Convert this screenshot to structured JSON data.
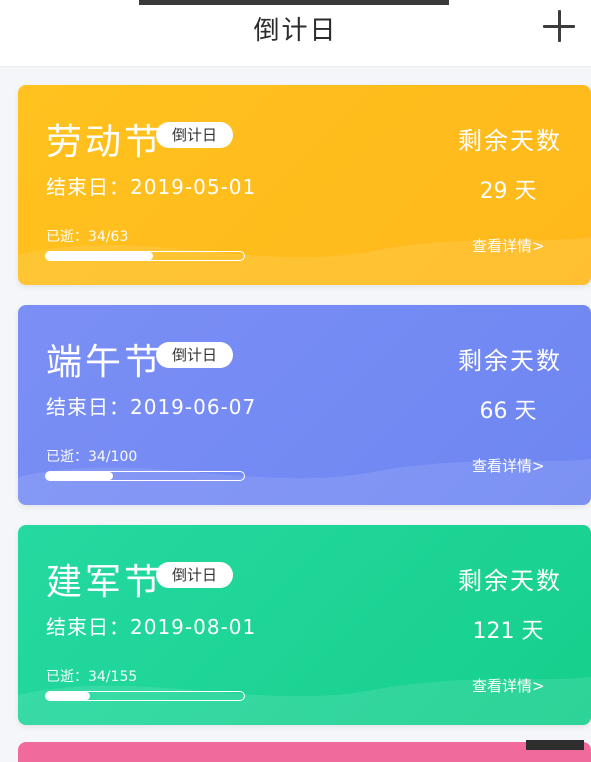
{
  "header": {
    "title": "倒计日",
    "add_icon": "plus-icon"
  },
  "cards": [
    {
      "name": "劳动节",
      "badge": "倒计日",
      "end_date": "结束日：2019-05-01",
      "elapsed": "已逝：34/63",
      "progress": 0.54,
      "remaining_label": "剩余天数",
      "days": "29 天",
      "details": "查看详情>",
      "color_start": "#ffc21f",
      "color_end": "#ffb81a"
    },
    {
      "name": "端午节",
      "badge": "倒计日",
      "end_date": "结束日：2019-06-07",
      "elapsed": "已逝：34/100",
      "progress": 0.34,
      "remaining_label": "剩余天数",
      "days": "66 天",
      "details": "查看详情>",
      "color_start": "#7b8ff5",
      "color_end": "#6e86f2"
    },
    {
      "name": "建军节",
      "badge": "倒计日",
      "end_date": "结束日：2019-08-01",
      "elapsed": "已逝：34/155",
      "progress": 0.22,
      "remaining_label": "剩余天数",
      "days": "121 天",
      "details": "查看详情>",
      "color_start": "#25d9a0",
      "color_end": "#16cf8c"
    }
  ]
}
